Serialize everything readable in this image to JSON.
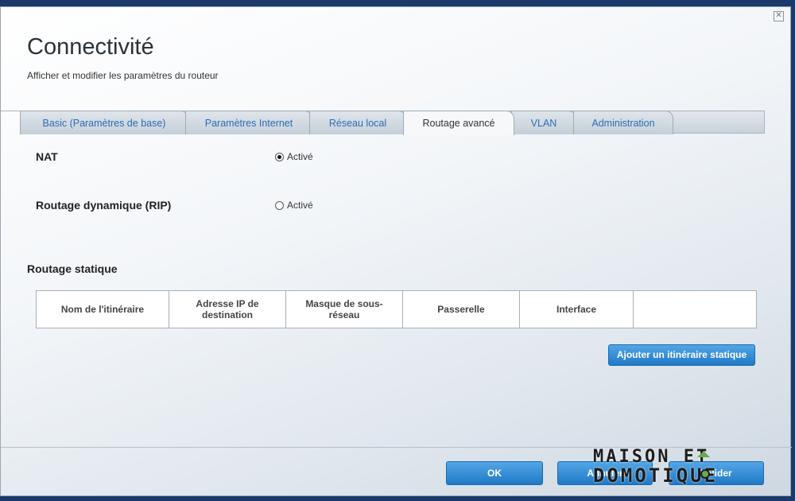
{
  "window": {
    "title": "Connectivité",
    "subtitle": "Afficher et modifier les paramètres du routeur",
    "close_glyph": "✕"
  },
  "tabs": [
    {
      "label": "Basic (Paramètres de base)",
      "active": false
    },
    {
      "label": "Paramètres Internet",
      "active": false
    },
    {
      "label": "Réseau local",
      "active": false
    },
    {
      "label": "Routage avancé",
      "active": true
    },
    {
      "label": "VLAN",
      "active": false
    },
    {
      "label": "Administration",
      "active": false
    }
  ],
  "nat": {
    "label": "NAT",
    "option_label": "Activé",
    "checked": true
  },
  "rip": {
    "label": "Routage dynamique (RIP)",
    "option_label": "Activé",
    "checked": false
  },
  "static_routing": {
    "title": "Routage statique",
    "columns": [
      "Nom de l'itinéraire",
      "Adresse IP de destination",
      "Masque de sous-réseau",
      "Passerelle",
      "Interface",
      ""
    ],
    "add_button": "Ajouter un itinéraire statique"
  },
  "footer": {
    "ok": "OK",
    "cancel": "Annuler",
    "save": "Valider"
  },
  "watermark": {
    "line1": "MAISON ET",
    "line2": "DOMOTIQUE"
  },
  "colors": {
    "accent": "#2a7bc8",
    "tab_text": "#2a6db5"
  }
}
